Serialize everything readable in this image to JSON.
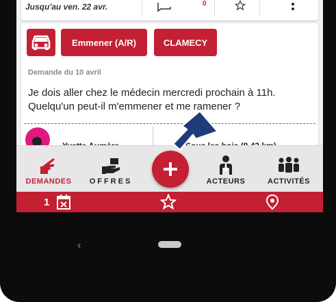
{
  "top_card": {
    "date_text": "Jusqu'au ven. 22 avr.",
    "count": "0",
    "icons": [
      "chat-icon",
      "star-outline-icon",
      "more-vert-icon"
    ]
  },
  "card": {
    "chips": {
      "car_icon": "car-icon",
      "trip_label": "Emmener (A/R)",
      "town_label": "CLAMECY"
    },
    "date_label": "Demande du 10 avril",
    "message": "Je dois aller chez le médecin mercredi prochain à 11h. Quelqu'un peut-il m'emmener et me ramener ?",
    "author": "Yvette Aumère",
    "location": "Sous les bois (8,43 km)"
  },
  "tabs": [
    {
      "label": "DEMANDES",
      "icon": "hand-pointing-icon",
      "active": true
    },
    {
      "label": "OFFRES",
      "icon": "offering-hand-icon",
      "active": false
    },
    {
      "label": "ACTEURS",
      "icon": "person-tie-icon",
      "active": false
    },
    {
      "label": "ACTIVITÉS",
      "icon": "people-group-icon",
      "active": false
    }
  ],
  "fab": {
    "icon": "plus-icon"
  },
  "bottom_bar": {
    "calendar_count": "1",
    "calendar_icon": "calendar-x-icon",
    "favorites_icon": "star-outline-icon",
    "location_icon": "location-pin-icon"
  },
  "system_nav": {
    "back_icon": "back-chevron-icon",
    "home_icon": "home-pill-icon"
  },
  "colors": {
    "brand_red": "#c32033",
    "pointer_blue": "#1f3c7a",
    "avatar_pink": "#e0187f"
  }
}
